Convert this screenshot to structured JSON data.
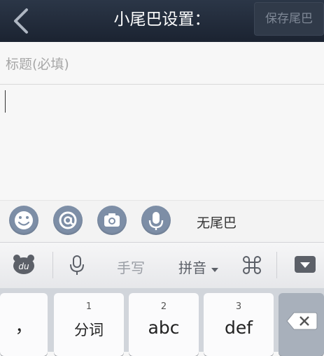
{
  "header": {
    "title": "小尾巴设置：",
    "save_label": "保存尾巴"
  },
  "form": {
    "subject_placeholder": "标题(必填)"
  },
  "toolbar": {
    "icons": [
      "emoji-icon",
      "at-icon",
      "camera-icon",
      "microphone-icon"
    ],
    "tail_label": "无尾巴"
  },
  "keyboard": {
    "header": {
      "logo": "du",
      "handwriting_label": "手写",
      "pinyin_label": "拼音"
    },
    "keys": [
      {
        "num": "",
        "label": "，"
      },
      {
        "num": "1",
        "label": "分词"
      },
      {
        "num": "2",
        "label": "abc"
      },
      {
        "num": "3",
        "label": "def"
      }
    ],
    "delete_icon": "backspace-icon"
  },
  "colors": {
    "topbar": "#1f2836",
    "icon_circle": "#7d8ea6"
  }
}
